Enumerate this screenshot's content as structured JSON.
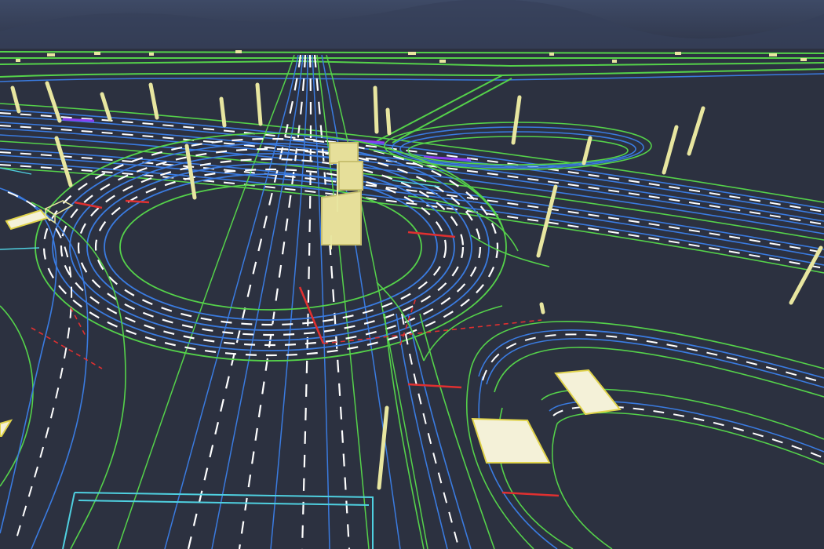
{
  "scene": {
    "view": "3d-hd-map",
    "colors": {
      "background": "#2c3140",
      "sky_top": "#3e4a66",
      "sky_bottom": "#2f364a",
      "lane_divider": "#ffffff",
      "lane_line": "#3a7be0",
      "road_boundary": "#55d24a",
      "stop_line": "#e03030",
      "crosswalk": "#f4f1d8",
      "crosswalk_outline": "#e0d34a",
      "pole": "#e8e6a0",
      "structure": "#e6df9a",
      "parking_area": "#4fd0e0",
      "overpass_accent": "#8a3df0"
    }
  }
}
